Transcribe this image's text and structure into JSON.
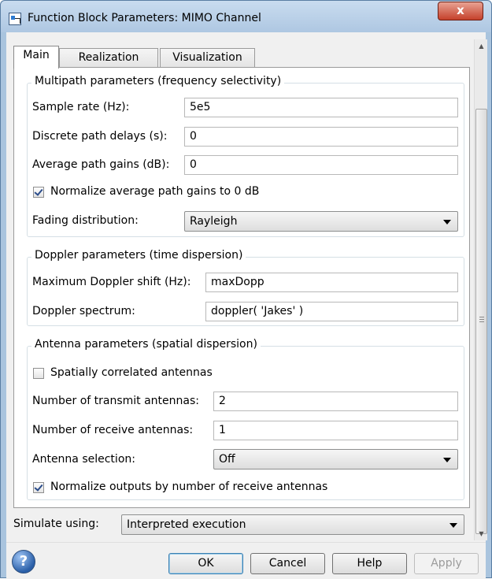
{
  "window": {
    "title": "Function Block Parameters: MIMO Channel",
    "close_label": "x"
  },
  "tabs": [
    {
      "label": "Main",
      "active": true
    },
    {
      "label": "Realization",
      "active": false
    },
    {
      "label": "Visualization",
      "active": false
    }
  ],
  "multipath": {
    "legend": "Multipath parameters (frequency selectivity)",
    "sample_rate_label": "Sample rate (Hz):",
    "sample_rate_value": "5e5",
    "path_delays_label": "Discrete path delays (s):",
    "path_delays_value": "0",
    "path_gains_label": "Average path gains (dB):",
    "path_gains_value": "0",
    "normalize_label": "Normalize average path gains to 0 dB",
    "normalize_checked": true,
    "fading_label": "Fading distribution:",
    "fading_value": "Rayleigh"
  },
  "doppler": {
    "legend": "Doppler parameters (time dispersion)",
    "max_shift_label": "Maximum Doppler shift (Hz):",
    "max_shift_value": "maxDopp",
    "spectrum_label": "Doppler spectrum:",
    "spectrum_value": "doppler( 'Jakes' )"
  },
  "antenna": {
    "legend": "Antenna parameters (spatial dispersion)",
    "spatially_correlated_label": "Spatially correlated antennas",
    "spatially_correlated_checked": false,
    "transmit_label": "Number of transmit antennas:",
    "transmit_value": "2",
    "receive_label": "Number of receive antennas:",
    "receive_value": "1",
    "selection_label": "Antenna selection:",
    "selection_value": "Off",
    "normalize_outputs_label": "Normalize outputs by number of receive antennas",
    "normalize_outputs_checked": true
  },
  "simulate": {
    "label": "Simulate using:",
    "value": "Interpreted execution"
  },
  "buttons": {
    "help_icon": "?",
    "ok": "OK",
    "cancel": "Cancel",
    "help": "Help",
    "apply": "Apply"
  },
  "icons": {
    "scroll_up": "▲",
    "scroll_down": "▼"
  },
  "colors": {
    "title_bar": "#aec7e2",
    "close_button": "#c5412b",
    "panel_background": "#ffffff",
    "dialog_background": "#f0f0f0"
  }
}
